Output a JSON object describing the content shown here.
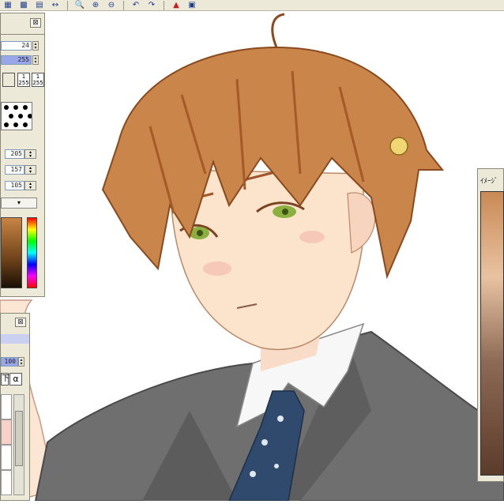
{
  "toolbar": {
    "icons": [
      "grid-icon",
      "transparency-icon",
      "mesh-icon",
      "fit-width-icon",
      "zoom-icon",
      "zoom-in-icon",
      "zoom-out-icon",
      "undo-icon",
      "redo-icon",
      "clear-icon",
      "layer-icon"
    ]
  },
  "color_panel": {
    "brush_size": "24",
    "opacity": "255",
    "min_a": "1",
    "min_a_val": "255",
    "min_b": "1",
    "min_b_val": "255",
    "rgb_r": "205",
    "rgb_g": "157",
    "rgb_b": "105",
    "close_glyph": "⊠",
    "dropdown_glyph": "▾"
  },
  "layer_panel": {
    "opacity": "100",
    "tool_a": "下",
    "tool_b": "α",
    "close_glyph": "⊠"
  },
  "nav_panel": {
    "title": "ｲﾒｰｼﾞ"
  },
  "colors": {
    "panel_bg": "#ece9d8",
    "slider_blue": "#9aa6e8",
    "hair": "#c9854a",
    "suit": "#6f6f6f"
  }
}
